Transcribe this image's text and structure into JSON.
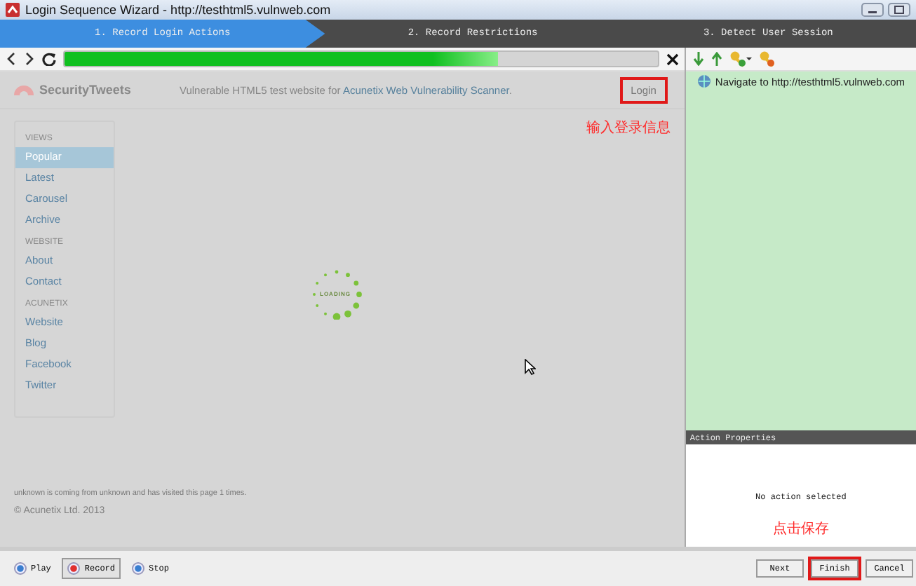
{
  "window": {
    "title": "Login Sequence Wizard - http://testhtml5.vulnweb.com"
  },
  "steps": [
    {
      "label": "1. Record Login Actions",
      "selected": true
    },
    {
      "label": "2. Record Restrictions",
      "selected": false
    },
    {
      "label": "3. Detect User Session",
      "selected": false
    }
  ],
  "browser": {
    "progress": {
      "level": 0.73
    },
    "site": {
      "brand": "SecurityTweets",
      "tagline": "Vulnerable HTML5 test website for ",
      "tagline_link": "Acunetix Web Vulnerability Scanner",
      "tagline_end": ".",
      "login": "Login",
      "sidebar": [
        {
          "heading": "VIEWS",
          "items": [
            {
              "label": "Popular",
              "selected": true
            },
            {
              "label": "Latest",
              "selected": false
            },
            {
              "label": "Carousel",
              "selected": false
            },
            {
              "label": "Archive",
              "selected": false
            }
          ]
        },
        {
          "heading": "WEBSITE",
          "items": [
            {
              "label": "About",
              "selected": false
            },
            {
              "label": "Contact",
              "selected": false
            }
          ]
        },
        {
          "heading": "ACUNETIX",
          "items": [
            {
              "label": "Website",
              "selected": false
            },
            {
              "label": "Blog",
              "selected": false
            },
            {
              "label": "Facebook",
              "selected": false
            },
            {
              "label": "Twitter",
              "selected": false
            }
          ]
        }
      ],
      "loading": "LOADING",
      "visit_note": "unknown is coming from unknown and has visited this page 1 times.",
      "copyright": "© Acunetix Ltd. 2013"
    },
    "annotation": "输入登录信息"
  },
  "actions": {
    "items": [
      {
        "label": "Navigate to http://testhtml5.vulnweb.com"
      }
    ]
  },
  "properties": {
    "title": "Action Properties",
    "message": "No action selected",
    "annotation": "点击保存"
  },
  "recorder": [
    {
      "label": "Play",
      "selected": false,
      "color": "#3a7fd0"
    },
    {
      "label": "Record",
      "selected": true,
      "color": "#e03030"
    },
    {
      "label": "Stop",
      "selected": false,
      "color": "#3a7fd0"
    }
  ],
  "buttons": [
    {
      "label": "Next",
      "highlighted": false
    },
    {
      "label": "Finish",
      "highlighted": true
    },
    {
      "label": "Cancel",
      "highlighted": false
    }
  ]
}
